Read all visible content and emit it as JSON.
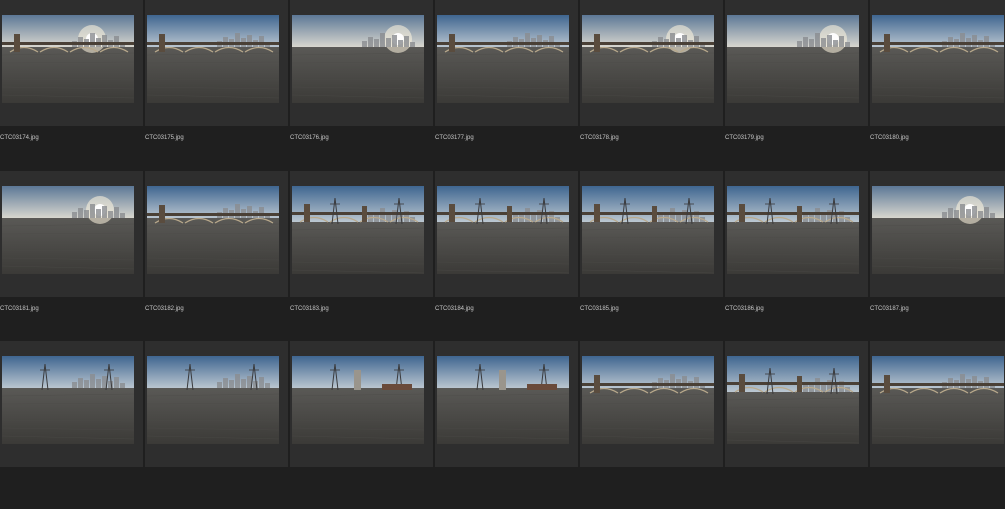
{
  "colors": {
    "background": "#1f1f1f",
    "cell": "#2e2e2e",
    "label_text": "#c8c8c8"
  },
  "photos": [
    {
      "filename": "CTC03174.jpg",
      "scene": "bridge-sunset"
    },
    {
      "filename": "CTC03175.jpg",
      "scene": "bridge-skyline"
    },
    {
      "filename": "CTC03176.jpg",
      "scene": "skyline-sun"
    },
    {
      "filename": "CTC03177.jpg",
      "scene": "bridge-skyline"
    },
    {
      "filename": "CTC03178.jpg",
      "scene": "bridge-sunset"
    },
    {
      "filename": "CTC03179.jpg",
      "scene": "skyline-sun"
    },
    {
      "filename": "CTC03180.jpg",
      "scene": "bridge-skyline"
    },
    {
      "filename": "CTC03181.jpg",
      "scene": "skyline-sun"
    },
    {
      "filename": "CTC03182.jpg",
      "scene": "bridge-skyline"
    },
    {
      "filename": "CTC03183.jpg",
      "scene": "bridge-arches"
    },
    {
      "filename": "CTC03184.jpg",
      "scene": "bridge-arches"
    },
    {
      "filename": "CTC03185.jpg",
      "scene": "bridge-arches"
    },
    {
      "filename": "CTC03186.jpg",
      "scene": "bridge-arches"
    },
    {
      "filename": "CTC03187.jpg",
      "scene": "skyline-sun"
    },
    {
      "filename": "",
      "scene": "towers-field"
    },
    {
      "filename": "",
      "scene": "towers-field"
    },
    {
      "filename": "",
      "scene": "rail-yard"
    },
    {
      "filename": "",
      "scene": "rail-yard"
    },
    {
      "filename": "",
      "scene": "bridge-skyline"
    },
    {
      "filename": "",
      "scene": "bridge-arches"
    },
    {
      "filename": "",
      "scene": "bridge-skyline"
    }
  ]
}
